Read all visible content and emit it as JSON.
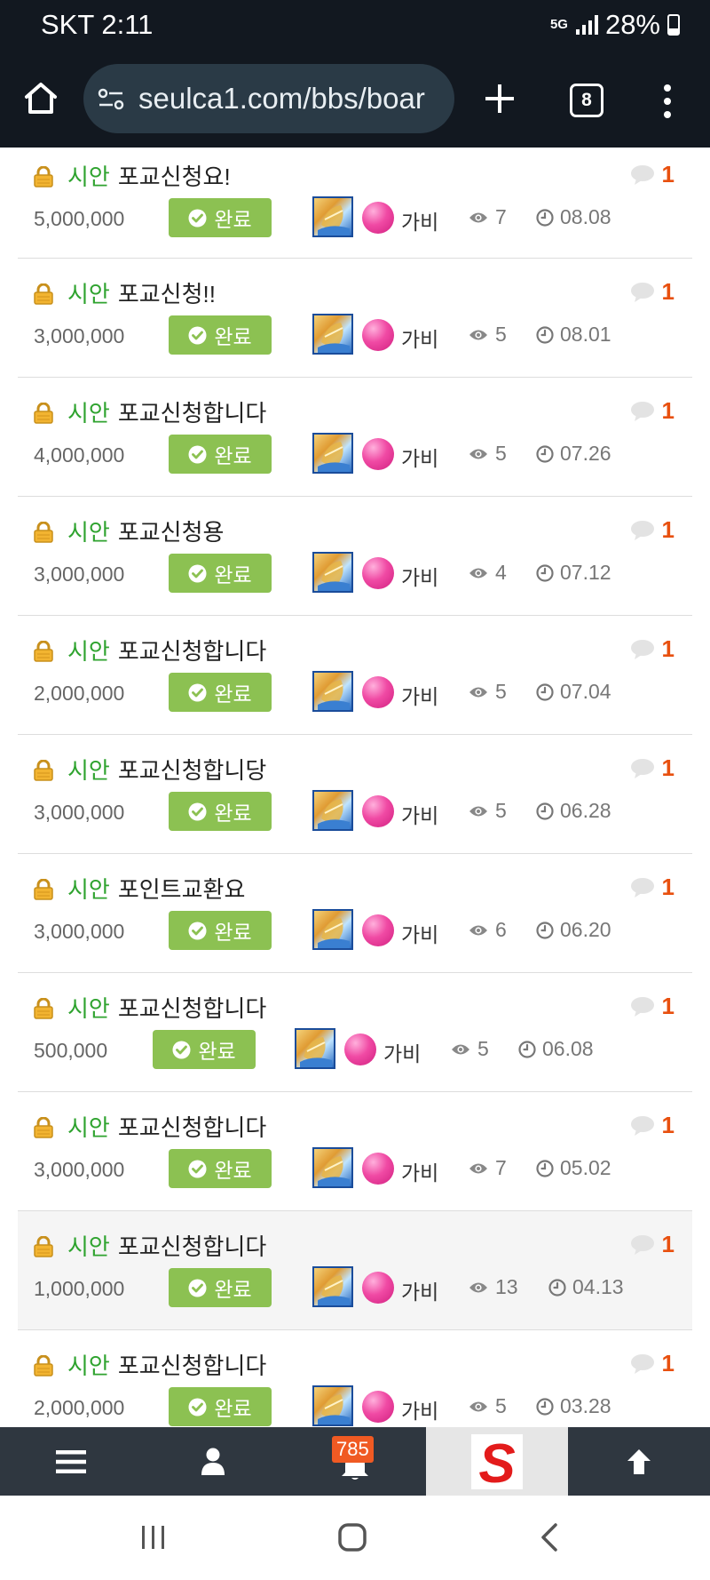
{
  "status_bar": {
    "carrier_time": "SKT 2:11",
    "network": "5G",
    "battery": "28%"
  },
  "browser": {
    "url": "seulca1.com/bbs/boar",
    "tab_count": "8"
  },
  "posts": [
    {
      "category": "시안",
      "title": "포교신청요!",
      "comments": "1",
      "points": "5,000,000",
      "status": "완료",
      "author": "가비",
      "views": "7",
      "date": "08.08"
    },
    {
      "category": "시안",
      "title": "포교신청!!",
      "comments": "1",
      "points": "3,000,000",
      "status": "완료",
      "author": "가비",
      "views": "5",
      "date": "08.01"
    },
    {
      "category": "시안",
      "title": "포교신청합니다",
      "comments": "1",
      "points": "4,000,000",
      "status": "완료",
      "author": "가비",
      "views": "5",
      "date": "07.26"
    },
    {
      "category": "시안",
      "title": "포교신청용",
      "comments": "1",
      "points": "3,000,000",
      "status": "완료",
      "author": "가비",
      "views": "4",
      "date": "07.12"
    },
    {
      "category": "시안",
      "title": "포교신청합니다",
      "comments": "1",
      "points": "2,000,000",
      "status": "완료",
      "author": "가비",
      "views": "5",
      "date": "07.04"
    },
    {
      "category": "시안",
      "title": "포교신청합니당",
      "comments": "1",
      "points": "3,000,000",
      "status": "완료",
      "author": "가비",
      "views": "5",
      "date": "06.28"
    },
    {
      "category": "시안",
      "title": "포인트교환요",
      "comments": "1",
      "points": "3,000,000",
      "status": "완료",
      "author": "가비",
      "views": "6",
      "date": "06.20"
    },
    {
      "category": "시안",
      "title": "포교신청합니다",
      "comments": "1",
      "points": "500,000",
      "status": "완료",
      "author": "가비",
      "views": "5",
      "date": "06.08"
    },
    {
      "category": "시안",
      "title": "포교신청합니다",
      "comments": "1",
      "points": "3,000,000",
      "status": "완료",
      "author": "가비",
      "views": "7",
      "date": "05.02"
    },
    {
      "category": "시안",
      "title": "포교신청합니다",
      "comments": "1",
      "points": "1,000,000",
      "status": "완료",
      "author": "가비",
      "views": "13",
      "date": "04.13"
    },
    {
      "category": "시안",
      "title": "포교신청합니다",
      "comments": "1",
      "points": "2,000,000",
      "status": "완료",
      "author": "가비",
      "views": "5",
      "date": "03.28"
    }
  ],
  "bottom_bar": {
    "notification_count": "785",
    "logo_letter": "S"
  },
  "icons": [
    "home-icon",
    "site-settings-icon",
    "plus-icon",
    "menu-icon",
    "lock-icon",
    "comment-icon",
    "check-circle-icon",
    "eye-icon",
    "clock-icon",
    "hamburger-icon",
    "user-icon",
    "bell-icon",
    "arrow-up-icon",
    "recents-icon",
    "home-nav-icon",
    "back-icon"
  ],
  "colors": {
    "category": "#2fa32f",
    "comment_count": "#e8500f",
    "badge_bg": "#8cc152",
    "top_bar": "#121820",
    "bottom_bar": "#2f3740",
    "notification_badge": "#f05a23"
  }
}
